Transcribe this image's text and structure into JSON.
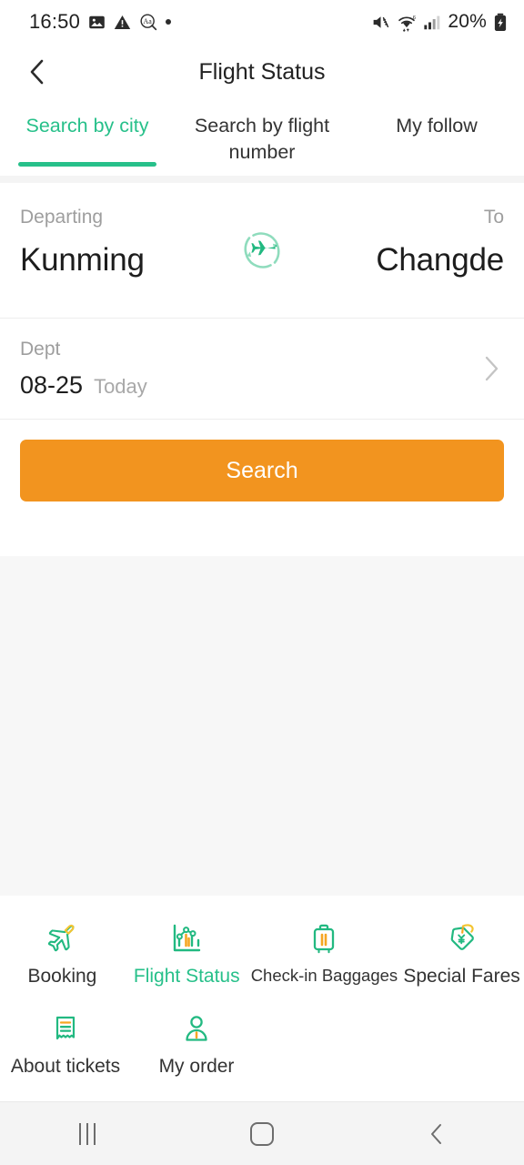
{
  "status_bar": {
    "time": "16:50",
    "left_icons": [
      "image-icon",
      "warning-icon",
      "text-size-icon",
      "dot-icon"
    ],
    "right_icons": [
      "mute-icon",
      "wifi-icon",
      "signal-icon"
    ],
    "battery_percent": "20%",
    "battery_icon": "battery-charging-icon"
  },
  "header": {
    "back_icon": "chevron-left-icon",
    "title": "Flight Status"
  },
  "tabs": {
    "items": [
      {
        "label": "Search by city",
        "active": true
      },
      {
        "label": "Search by flight number",
        "active": false
      },
      {
        "label": "My follow",
        "active": false
      }
    ]
  },
  "search_form": {
    "departing_caption": "Departing",
    "departing_city": "Kunming",
    "to_caption": "To",
    "to_city": "Changde",
    "swap_icon": "swap-plane-icon",
    "date_caption": "Dept",
    "date_value": "08-25",
    "date_sub": "Today",
    "date_chevron_icon": "chevron-right-icon",
    "search_label": "Search"
  },
  "bottom_grid": {
    "rows": [
      [
        {
          "label": "Booking",
          "icon": "plane-icon",
          "active": false,
          "shrink": false
        },
        {
          "label": "Flight Status",
          "icon": "chart-icon",
          "active": true,
          "shrink": false
        },
        {
          "label": "Check-in Baggages",
          "icon": "suitcase-icon",
          "active": false,
          "shrink": true
        },
        {
          "label": "Special Fares",
          "icon": "price-tag-icon",
          "active": false,
          "shrink": false
        }
      ],
      [
        {
          "label": "About tickets",
          "icon": "receipt-icon",
          "active": false,
          "shrink": false
        },
        {
          "label": "My order",
          "icon": "person-icon",
          "active": false,
          "shrink": false
        }
      ]
    ]
  },
  "android_nav": {
    "recents_icon": "recents-icon",
    "home_icon": "home-icon",
    "back_icon": "back-icon"
  },
  "colors": {
    "accent_green": "#27c08a",
    "accent_orange": "#f2941f",
    "page_background": "#f7f7f7"
  }
}
